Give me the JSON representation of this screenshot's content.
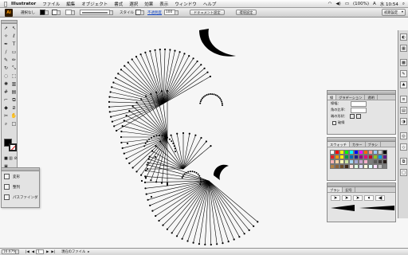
{
  "menubar": {
    "app_name": "Illustrator",
    "items": [
      "ファイル",
      "編集",
      "オブジェクト",
      "書式",
      "選択",
      "効果",
      "表示",
      "ウィンドウ",
      "ヘルプ"
    ],
    "battery": "(100%)",
    "clock": "水 10:54"
  },
  "control_bar": {
    "logo": "Ai",
    "label_no_selection": "選択なし",
    "label_style": "スタイル",
    "label_opacity": "不透明度",
    "opacity_value": "100",
    "btn_document_setup": "ドキュメント設定",
    "btn_preferences": "環境設定",
    "workspace": "初期設定"
  },
  "float_panel": {
    "items": [
      {
        "label": "変形",
        "icon": "transform-icon"
      },
      {
        "label": "整列",
        "icon": "align-icon"
      },
      {
        "label": "パスファインダ",
        "icon": "pathfinder-icon"
      }
    ]
  },
  "stroke_panel": {
    "tabs": [
      "線",
      "グラデーション",
      "透明"
    ],
    "rows": [
      "線幅：",
      "角の比率：",
      "端の形状："
    ],
    "checkbox_label": "破線"
  },
  "swatch_panel": {
    "tabs": [
      "スウォッチ",
      "カラー",
      "ブラシ"
    ],
    "colors": [
      "#ffffff",
      "#ff0000",
      "#ffff00",
      "#00ff00",
      "#00ffff",
      "#0000ff",
      "#ff00ff",
      "#ff6600",
      "#ff9999",
      "#99ccff",
      "#cccccc",
      "#000000",
      "#e61e25",
      "#f39800",
      "#fff100",
      "#009944",
      "#0068b7",
      "#1d2088",
      "#920783",
      "#e4007f",
      "#c30d23",
      "#8fc31f",
      "#00a0e9",
      "#601986",
      "#f5b2b2",
      "#fad3a3",
      "#fff9b1",
      "#cbe6a2",
      "#a3d7f1",
      "#a4a8d4",
      "#c9a0ce",
      "#f5b0cb",
      "#7d7d7d",
      "#595757",
      "#3e3a39",
      "#231815",
      "#b28146",
      "#8c6239",
      "#6b4c2a",
      "#3f2b18",
      "#ffe1e1",
      "#e1ffe1",
      "#e1e1ff",
      "#ffffe1",
      "#e1ffff",
      "#ffe1ff",
      "#c0c0c0",
      "#808080"
    ]
  },
  "brush_panel": {
    "tabs": [
      "ブラシ",
      "記号"
    ],
    "brushes": [
      "➤",
      "➤",
      "➤",
      "➧",
      "◀"
    ]
  },
  "statusbar": {
    "zoom": "16.67%",
    "page": "1",
    "status_text": "現在のファイル"
  }
}
